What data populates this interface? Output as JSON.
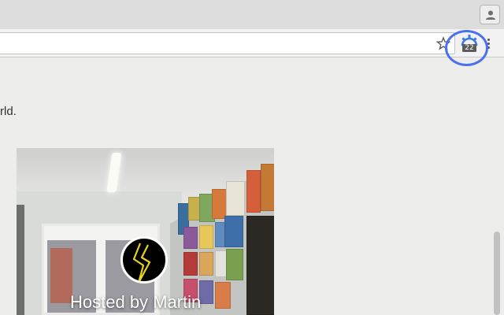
{
  "toolbar": {
    "extension_badge": "22"
  },
  "page": {
    "partial_text": "rld.",
    "host_label": "Hosted by Martin"
  },
  "colors": {
    "highlight_ring": "#4a6ff0",
    "extension_icon": "#3b78e7"
  },
  "icons": [
    "profile-icon",
    "bookmark-star-icon",
    "extension-icon",
    "chrome-menu-icon"
  ]
}
